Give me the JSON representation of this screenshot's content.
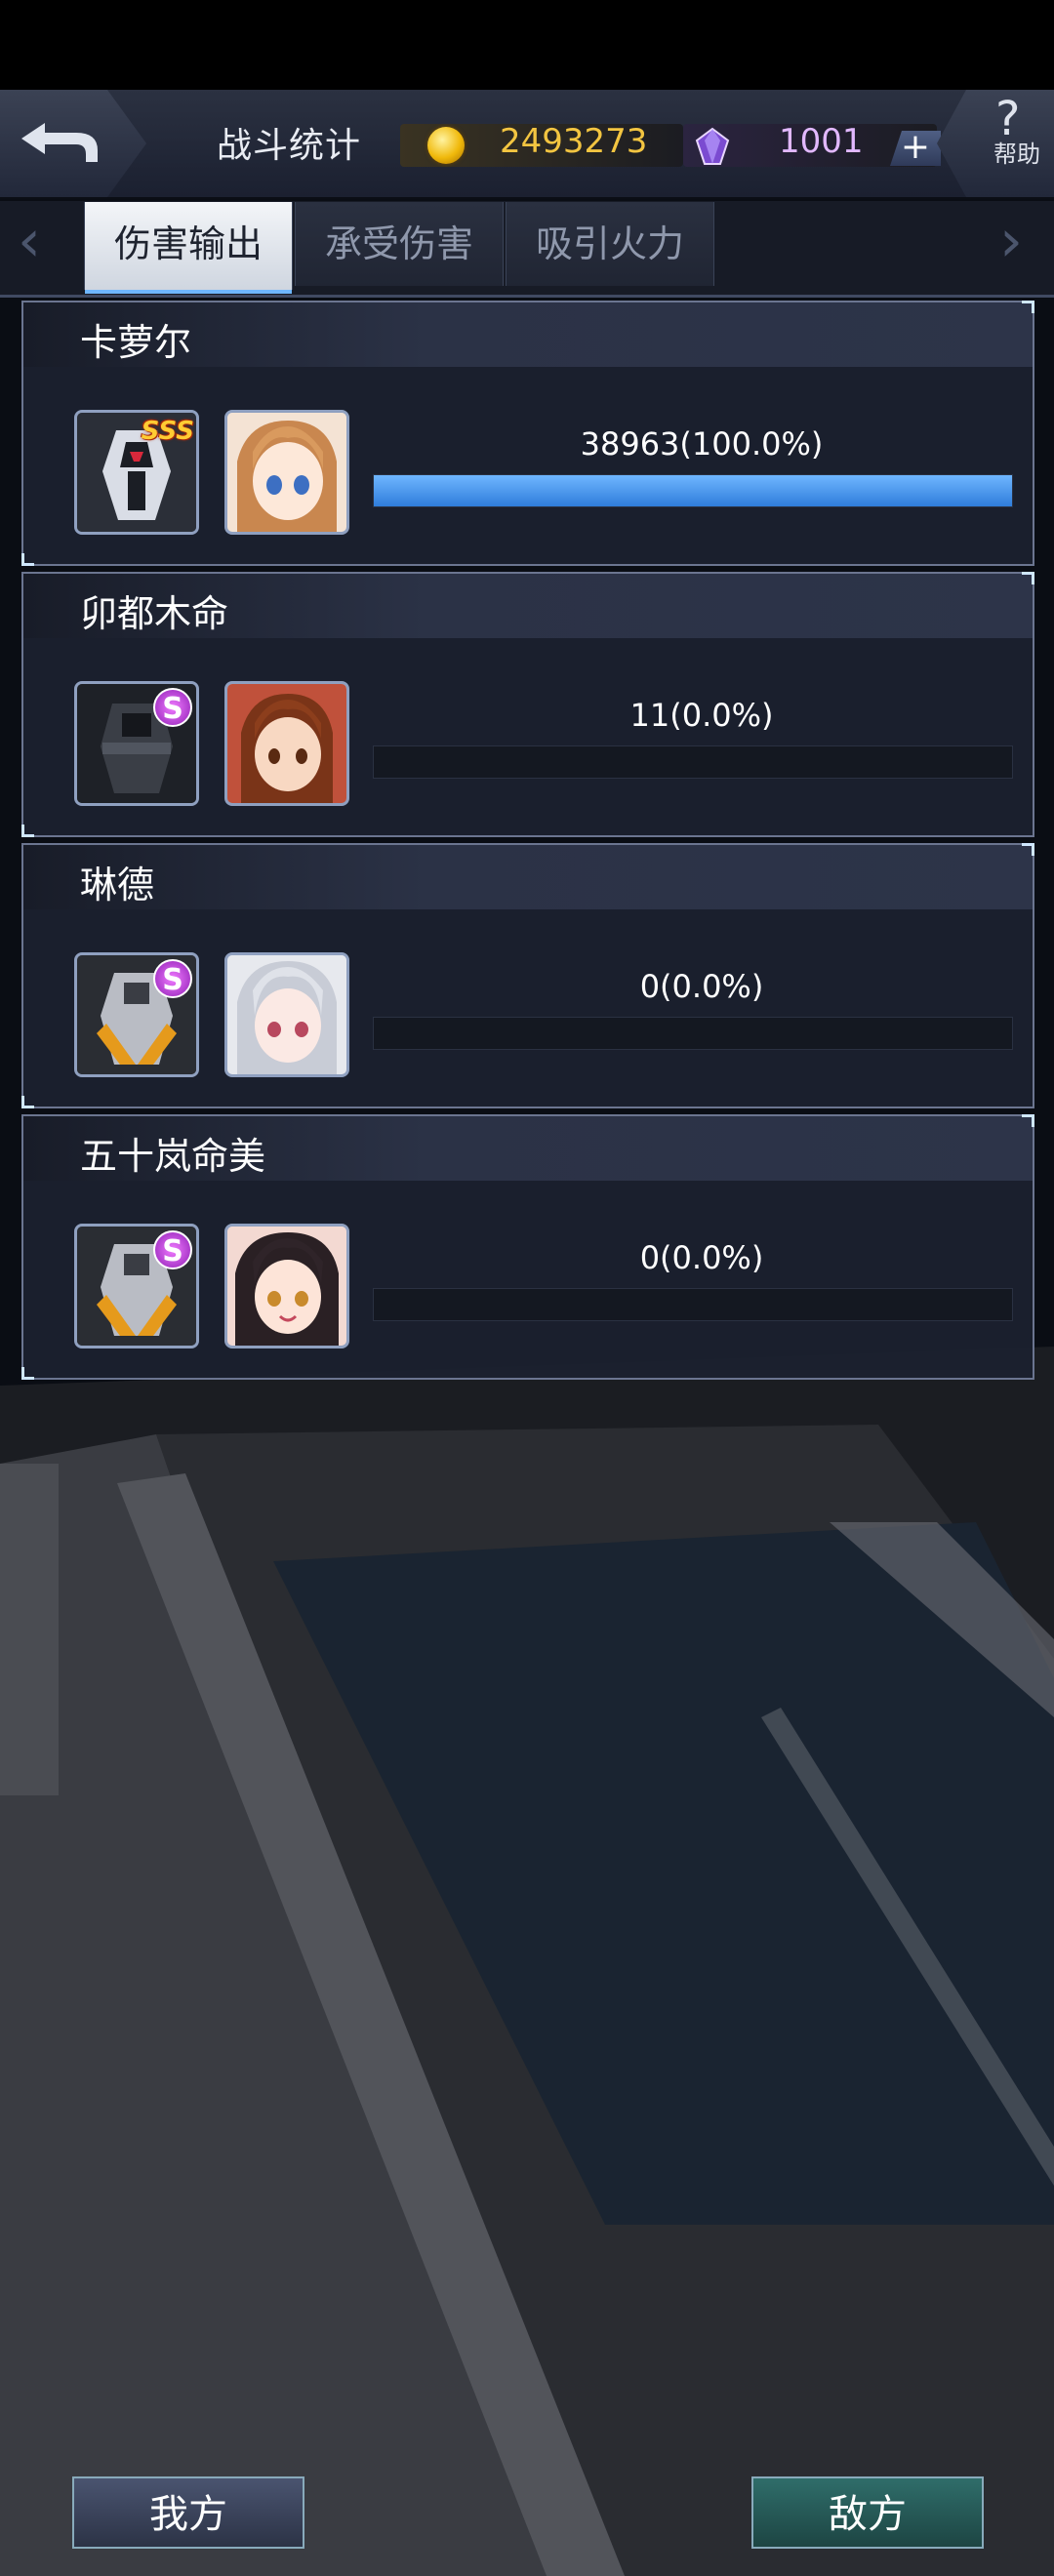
{
  "header": {
    "title": "战斗统计",
    "gold": "2493273",
    "gems": "1001",
    "plus_label": "+",
    "help_label": "帮助",
    "help_icon": "?"
  },
  "tabs": [
    {
      "label": "伤害输出",
      "active": true
    },
    {
      "label": "承受伤害",
      "active": false
    },
    {
      "label": "吸引火力",
      "active": false
    }
  ],
  "nav": {
    "left_arrow": "‹",
    "right_arrow": "›"
  },
  "stats": [
    {
      "name": "卡萝尔",
      "value_text": "38963(100.0%)",
      "fraction": 1.0,
      "mech_rank": "SSS",
      "pilot_icon": "pilot-carol"
    },
    {
      "name": "卯都木命",
      "value_text": "11(0.0%)",
      "fraction": 0.0,
      "mech_rank": "S",
      "pilot_icon": "pilot-mikoto"
    },
    {
      "name": "琳德",
      "value_text": "0(0.0%)",
      "fraction": 0.0,
      "mech_rank": "S",
      "pilot_icon": "pilot-linde"
    },
    {
      "name": "五十岚命美",
      "value_text": "0(0.0%)",
      "fraction": 0.0,
      "mech_rank": "S",
      "pilot_icon": "pilot-igarashi"
    }
  ],
  "footer": {
    "ours_label": "我方",
    "enemy_label": "敌方"
  },
  "colors": {
    "gold": "#f3c541",
    "gem": "#e2b8ff",
    "bar_fill": "#3a8ae6",
    "bar_track": "#141821"
  }
}
